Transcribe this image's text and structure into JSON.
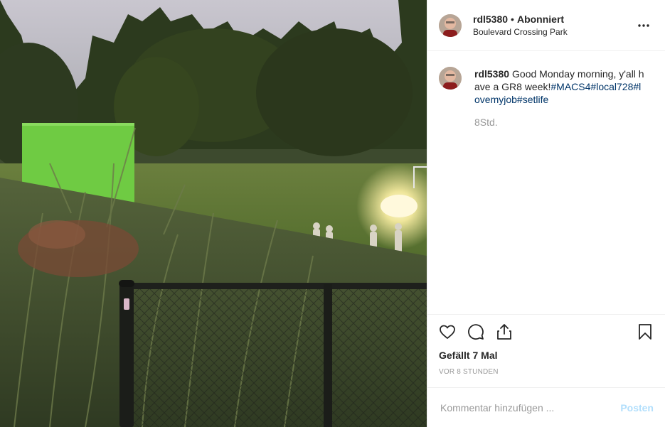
{
  "photo": {
    "alt_icon": "photo-image"
  },
  "header": {
    "username": "rdl5380",
    "separator": "•",
    "follow_status": "Abonniert",
    "location": "Boulevard Crossing Park",
    "more_icon": "more-horizontal-icon"
  },
  "caption": {
    "username": "rdl5380",
    "text": "Good Monday morning, y'all have a GR8 week!",
    "hashtags": [
      "#MACS4",
      "#local728",
      "#lovemyjob",
      "#setlife"
    ],
    "time": "8Std."
  },
  "actions": {
    "like_icon": "heart-icon",
    "comment_icon": "comment-icon",
    "share_icon": "share-icon",
    "save_icon": "bookmark-icon"
  },
  "likes": {
    "prefix": "Gefällt",
    "count": "7",
    "suffix": "Mal"
  },
  "post_time": "VOR 8 STUNDEN",
  "comment_box": {
    "placeholder": "Kommentar hinzufügen ...",
    "post_label": "Posten"
  },
  "colors": {
    "hashtag": "#003569",
    "muted": "#999999",
    "post_button_disabled": "#b2dffc",
    "border": "#efefef"
  }
}
